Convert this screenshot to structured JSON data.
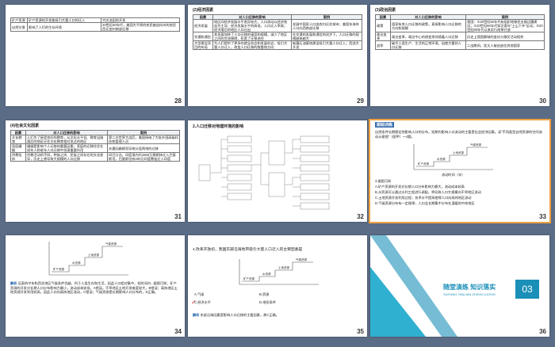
{
  "slides": {
    "s28": {
      "number": "28",
      "rows": [
        {
          "factor": "矿产资源",
          "effect": "矿产资源的开发能吸引大量人口的迁入",
          "example": "大庆油田的开发"
        },
        {
          "factor": "自然灾害",
          "effect": "影响了人们的生存环境",
          "example": "20世纪30年代，美国大平原的农民被迫向州的农民西迁加州南部迁移"
        }
      ]
    },
    "s29": {
      "number": "29",
      "title": "(2)经济因素",
      "headers": [
        "因素",
        "对人口迁移的影响",
        "案例"
      ],
      "rows": [
        {
          "factor": "经济发展",
          "effect": "地区间经济发展水平差异较大，人口流动以经济效益为主导；经济发展水平的高低，人口迁入率高；经济落后的地区人口迁出",
          "example": "发展中国家人口由农村迁往城市；美国东海岸人口向西南部迁移"
        },
        {
          "factor": "交通和通信",
          "effect": "其发展加快了人口迁移的速度和规模，减少了地区之间的交流障碍，拓宽了迁移途径",
          "example": "在交通的发展和通信的进步下，人口迁移的规模越来越大"
        },
        {
          "factor": "大型建设项目的布局",
          "effect": "为人们提供了更多的就业机会和发展机会，吸引大量人口迁入，改变人口迁移的数量和方向",
          "example": "新疆石油基地建设吸引大量人口迁入；西部大开发"
        }
      ]
    },
    "s30": {
      "number": "30",
      "title": "(3)政治因素",
      "headers": [
        "因素",
        "对人口迁移的影响",
        "案例"
      ],
      "rows": [
        {
          "factor": "政策",
          "effect": "国家有关人口迁移的政策，直接影响人口迁移的方向和规模",
          "example": "我国：①20世纪50年代有组织地移民支援边疆建设；②20世纪60年代知识青年\"上山下乡\"运动；③20世纪80年代以来实行改革开放"
        },
        {
          "factor": "政治变革",
          "effect": "政治变革，政治中心的改变常伴随着人口迁移",
          "example": "历史上我国都城的变化与移民活动相关"
        },
        {
          "factor": "战争",
          "effect": "破坏人类生产、生活的正常环境，迫使大量的人口迁移",
          "example": "二战期间，犹太人被迫逃往其他国家"
        }
      ]
    },
    "s31": {
      "number": "31",
      "title": "(4)社会文化因素",
      "headers": [
        "因素",
        "对人口迁移的影响",
        "案例"
      ],
      "rows": [
        {
          "factor": "文化教育",
          "effect": "人们为了接受良好的教育，从文化水平低、教育设施落后的地区迁往文化教育相对发达的地区",
          "example": "第二次世界大战后，美国接纳了大批外国高级科技和管理人员"
        },
        {
          "factor": "家庭婚姻",
          "effect": "婚姻是影响个人迁移的重要因素；家庭的迁移往往在成年人和老年人口迁移中扮演重要作用",
          "example": "夫妻因婚嫁而导致分居两地的迁移"
        },
        {
          "factor": "宗教信仰",
          "effect": "宗教活动的不同，种族之间、民族之间存在的文化差异，历史上曾导致大规模的人口迁移",
          "example": "印巴分治，印度境内约1500万穆斯林迁入巴基斯坦，巴基斯坦有200万印度教徒迁入印度"
        }
      ]
    },
    "s32": {
      "number": "32",
      "title": "2.人口迁移对地理环境的影响"
    },
    "s33": {
      "number": "33",
      "header": "跟踪训练",
      "question": "自然条件长期稳定地影响人口的分布，短期内影响人口流动的主要是社会经济因素。读“不同类型自然资源的空间流动示意图”（图甲）～4题。",
      "axis": "流动时间（年）",
      "choice_intro": "3.据图可知",
      "choices": [
        "A.矿产资源的开发对长期人口分布影响力最大，流动成本较高",
        "B.水资源可以通过水利工程进行调配，将导致人口大规模向干旱地区流动",
        "C.土地资源开发利用过程，技术水平提高使得人口向高纬地区流动",
        "D.气候资源分布有一定规律，人口会长期集中分布在温暖的中纬地区"
      ],
      "labels": [
        "气候资源",
        "土地资源",
        "水资源",
        "矿产资源"
      ]
    },
    "s34": {
      "number": "34",
      "jiexi_label": "解析",
      "explanation": "远离的中东和西北地区气候条件优越，利于人类生存和生活，因此人口相对集中，短时间内...据图可知，矿产资源的开发对长期人口分布影响力最小，流动成本较低，A错误。干旱地区土地开发难度较大，B错误；高纬地区土地资源开发利用较高，因此人口向高纬地区流动，C错误；气候资源是长期影响人口分布的，D正确。",
      "labels": [
        "气候资源",
        "土地资源",
        "水资源",
        "矿产资源"
      ]
    },
    "s35": {
      "number": "35",
      "question": "4.改革开放初，我国东部沿海地带吸引大量人口迁入的主要因素是",
      "options": [
        "A.气候",
        "B.资源",
        "C.经济水平",
        "D.地形条件"
      ],
      "checked_option": "C.经济水平",
      "jiexi_label": "解析",
      "explanation": "东部沿海因素是影响人口迁移的主要因素，故C正确。",
      "labels": [
        "气候资源",
        "土地资源",
        "水资源",
        "矿产资源"
      ]
    },
    "s36": {
      "number": "36",
      "title": "随堂演练 知识落实",
      "pinyin": "SUITANG YANLIAN ZHISHI LUOSHI",
      "badge": "03"
    }
  },
  "colors": {
    "accent": "#2fb0d0",
    "teal": "#1a8fb8",
    "jiexi": "#1a5fa8",
    "frame": "#5b6c86"
  }
}
